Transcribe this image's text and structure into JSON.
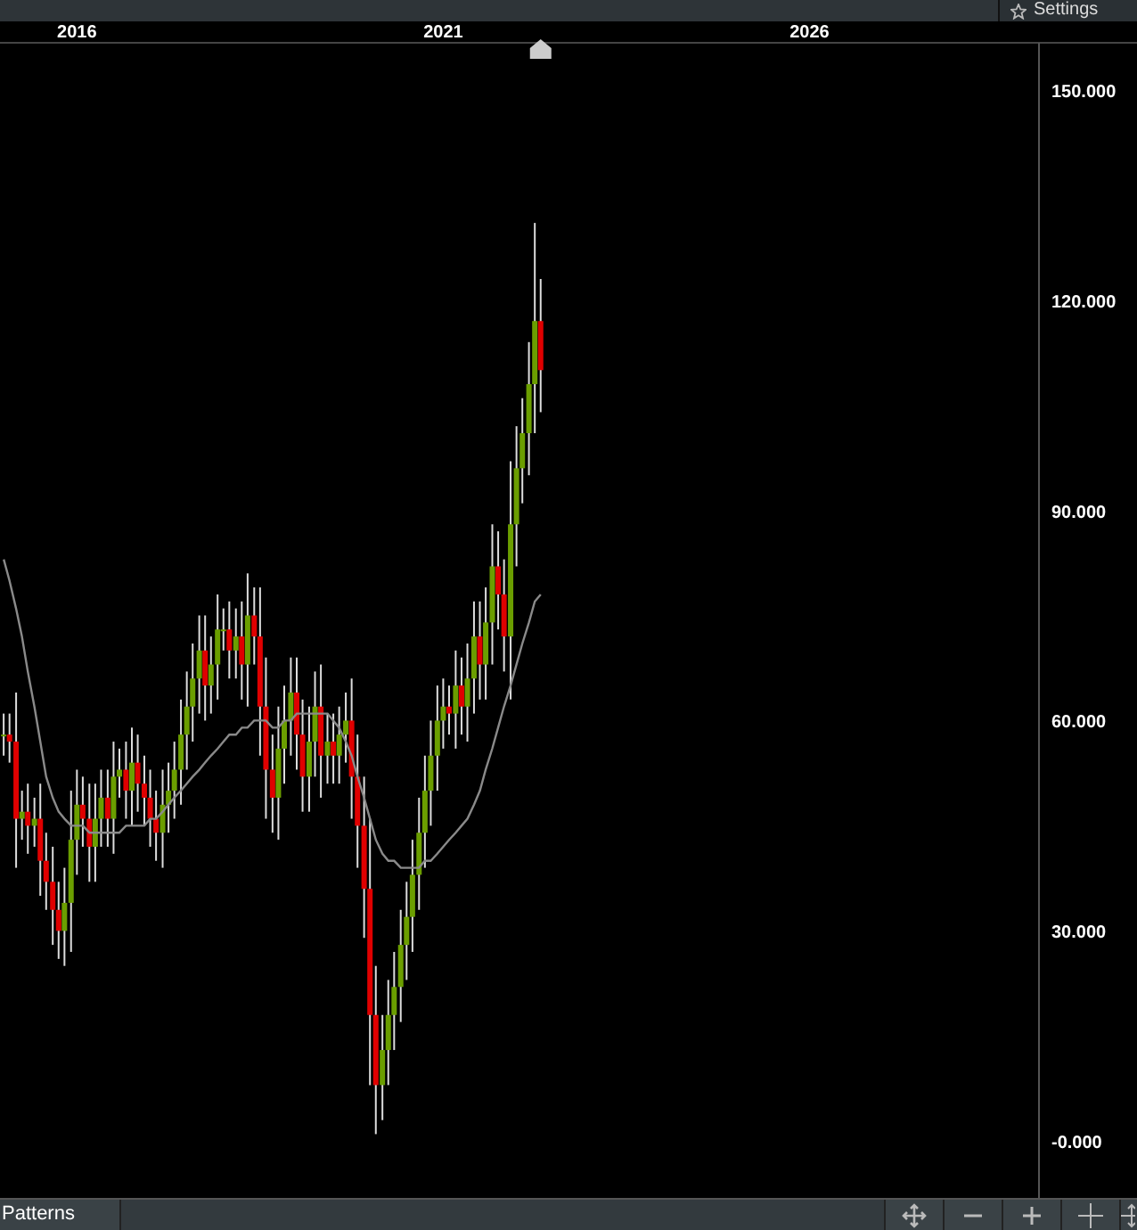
{
  "toolbar": {
    "settings_button": "Settings"
  },
  "chart": {
    "chart_data": {
      "type": "candlestick",
      "xlim": [
        2014.95,
        2030.47
      ],
      "ylim": [
        -8.1,
        156.7
      ],
      "xticks": [
        {
          "value": 2016,
          "label": "2016"
        },
        {
          "value": 2021,
          "label": "2021"
        },
        {
          "value": 2026,
          "label": "2026"
        }
      ],
      "yticks": [
        {
          "value": 150,
          "label": "150.000"
        },
        {
          "value": 120,
          "label": "120.000"
        },
        {
          "value": 90,
          "label": "90.000"
        },
        {
          "value": 60,
          "label": "60.000"
        },
        {
          "value": 30,
          "label": "30.000"
        },
        {
          "value": 0,
          "label": "-0.000"
        }
      ],
      "x": [
        2015.0,
        2015.08,
        2015.17,
        2015.25,
        2015.33,
        2015.42,
        2015.5,
        2015.58,
        2015.67,
        2015.75,
        2015.83,
        2015.92,
        2016.0,
        2016.08,
        2016.17,
        2016.25,
        2016.33,
        2016.42,
        2016.5,
        2016.58,
        2016.67,
        2016.75,
        2016.83,
        2016.92,
        2017.0,
        2017.08,
        2017.17,
        2017.25,
        2017.33,
        2017.42,
        2017.5,
        2017.58,
        2017.67,
        2017.75,
        2017.83,
        2017.92,
        2018.0,
        2018.08,
        2018.17,
        2018.25,
        2018.33,
        2018.42,
        2018.5,
        2018.58,
        2018.67,
        2018.75,
        2018.83,
        2018.92,
        2019.0,
        2019.08,
        2019.17,
        2019.25,
        2019.33,
        2019.42,
        2019.5,
        2019.58,
        2019.67,
        2019.75,
        2019.83,
        2019.92,
        2020.0,
        2020.08,
        2020.17,
        2020.25,
        2020.33,
        2020.42,
        2020.5,
        2020.58,
        2020.67,
        2020.75,
        2020.83,
        2020.92,
        2021.0,
        2021.08,
        2021.17,
        2021.25,
        2021.33,
        2021.42,
        2021.5,
        2021.58,
        2021.67,
        2021.75,
        2021.83,
        2021.92,
        2022.0,
        2022.08,
        2022.17,
        2022.25,
        2022.33
      ],
      "ohlc": [
        [
          58,
          61,
          55,
          58
        ],
        [
          58,
          61,
          54,
          57
        ],
        [
          57,
          64,
          39,
          46
        ],
        [
          46,
          50,
          43,
          47
        ],
        [
          47,
          51,
          41,
          45
        ],
        [
          45,
          49,
          42,
          46
        ],
        [
          46,
          51,
          35,
          40
        ],
        [
          40,
          44,
          33,
          37
        ],
        [
          37,
          42,
          28,
          33
        ],
        [
          33,
          37,
          26,
          30
        ],
        [
          30,
          39,
          25,
          34
        ],
        [
          34,
          50,
          27,
          43
        ],
        [
          43,
          53,
          38,
          48
        ],
        [
          48,
          52,
          42,
          46
        ],
        [
          46,
          51,
          37,
          42
        ],
        [
          42,
          51,
          37,
          46
        ],
        [
          46,
          53,
          42,
          49
        ],
        [
          49,
          53,
          42,
          46
        ],
        [
          46,
          57,
          41,
          52
        ],
        [
          52,
          56,
          49,
          53
        ],
        [
          53,
          57,
          46,
          50
        ],
        [
          50,
          59,
          45,
          54
        ],
        [
          54,
          58,
          47,
          51
        ],
        [
          51,
          55,
          45,
          49
        ],
        [
          49,
          53,
          42,
          46
        ],
        [
          46,
          50,
          40,
          44
        ],
        [
          44,
          53,
          39,
          48
        ],
        [
          48,
          54,
          44,
          50
        ],
        [
          50,
          57,
          46,
          53
        ],
        [
          53,
          63,
          48,
          58
        ],
        [
          58,
          67,
          53,
          62
        ],
        [
          62,
          71,
          57,
          66
        ],
        [
          66,
          75,
          61,
          70
        ],
        [
          70,
          75,
          60,
          65
        ],
        [
          65,
          72,
          61,
          68
        ],
        [
          68,
          78,
          63,
          73
        ],
        [
          73,
          76,
          70,
          73
        ],
        [
          73,
          77,
          66,
          70
        ],
        [
          70,
          76,
          66,
          72
        ],
        [
          72,
          77,
          63,
          68
        ],
        [
          68,
          81,
          62,
          75
        ],
        [
          75,
          79,
          68,
          72
        ],
        [
          72,
          79,
          55,
          62
        ],
        [
          62,
          69,
          46,
          53
        ],
        [
          53,
          58,
          44,
          49
        ],
        [
          49,
          62,
          43,
          56
        ],
        [
          56,
          65,
          51,
          60
        ],
        [
          60,
          69,
          55,
          64
        ],
        [
          64,
          69,
          53,
          58
        ],
        [
          58,
          63,
          47,
          52
        ],
        [
          52,
          62,
          47,
          57
        ],
        [
          57,
          67,
          52,
          62
        ],
        [
          62,
          68,
          49,
          55
        ],
        [
          55,
          61,
          51,
          57
        ],
        [
          57,
          61,
          51,
          55
        ],
        [
          55,
          62,
          51,
          58
        ],
        [
          58,
          64,
          54,
          60
        ],
        [
          60,
          66,
          46,
          52
        ],
        [
          52,
          58,
          39,
          45
        ],
        [
          45,
          52,
          29,
          36
        ],
        [
          36,
          46,
          8,
          18
        ],
        [
          18,
          25,
          1,
          8
        ],
        [
          8,
          18,
          3,
          13
        ],
        [
          13,
          23,
          8,
          18
        ],
        [
          18,
          27,
          13,
          22
        ],
        [
          22,
          33,
          17,
          28
        ],
        [
          28,
          37,
          23,
          32
        ],
        [
          32,
          43,
          27,
          38
        ],
        [
          38,
          49,
          33,
          44
        ],
        [
          44,
          55,
          39,
          50
        ],
        [
          50,
          60,
          45,
          55
        ],
        [
          55,
          65,
          50,
          60
        ],
        [
          60,
          66,
          56,
          62
        ],
        [
          62,
          65,
          58,
          61
        ],
        [
          61,
          70,
          56,
          65
        ],
        [
          65,
          69,
          58,
          62
        ],
        [
          62,
          71,
          57,
          66
        ],
        [
          66,
          77,
          61,
          72
        ],
        [
          72,
          77,
          63,
          68
        ],
        [
          68,
          79,
          63,
          74
        ],
        [
          74,
          88,
          68,
          82
        ],
        [
          82,
          87,
          73,
          78
        ],
        [
          78,
          83,
          67,
          72
        ],
        [
          72,
          97,
          63,
          88
        ],
        [
          88,
          102,
          82,
          96
        ],
        [
          96,
          106,
          91,
          101
        ],
        [
          101,
          114,
          95,
          108
        ],
        [
          108,
          131,
          101,
          117
        ],
        [
          117,
          123,
          104,
          110
        ]
      ],
      "series": [
        {
          "type": "line",
          "color": "#8a8a8a",
          "values": [
            83,
            80,
            76,
            72,
            67,
            62,
            57,
            52,
            49,
            47,
            46,
            45,
            45,
            45,
            44,
            44,
            44,
            44,
            44,
            44,
            45,
            45,
            45,
            45,
            46,
            46,
            47,
            48,
            49,
            50,
            51,
            52,
            53,
            54,
            55,
            56,
            57,
            58,
            58,
            59,
            59,
            60,
            60,
            60,
            59,
            59,
            60,
            60,
            61,
            61,
            61,
            61,
            61,
            61,
            60,
            59,
            57,
            55,
            52,
            49,
            46,
            43,
            41,
            40,
            40,
            39,
            39,
            39,
            39,
            40,
            40,
            41,
            42,
            43,
            44,
            45,
            46,
            48,
            50,
            53,
            56,
            59,
            62,
            65,
            68,
            71,
            74,
            77,
            78
          ]
        }
      ]
    }
  },
  "footer": {
    "patterns_tab": "Patterns"
  }
}
